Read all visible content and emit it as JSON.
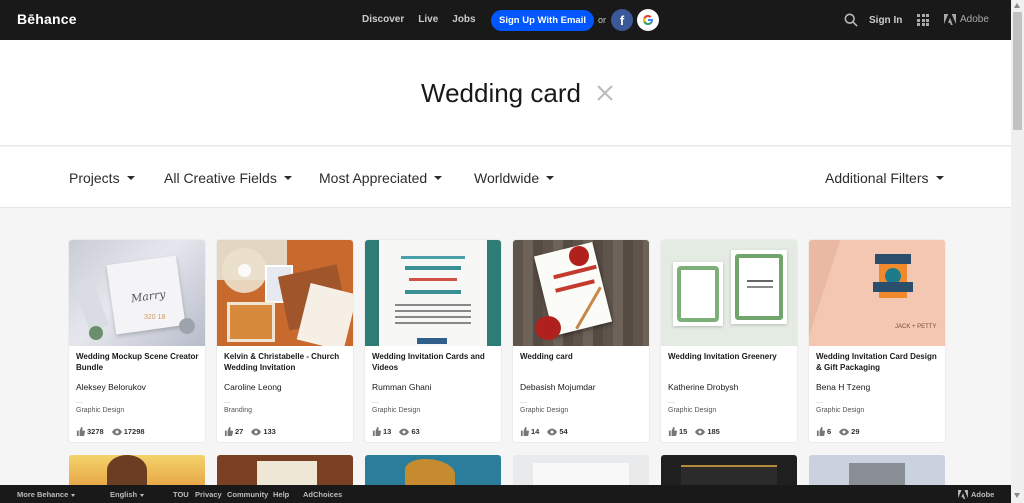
{
  "nav": {
    "logo": "Bēhance",
    "links": [
      "Discover",
      "Live",
      "Jobs"
    ],
    "signup": "Sign Up With Email",
    "or": "or",
    "signin": "Sign In",
    "adobe": "Adobe"
  },
  "search": {
    "query": "Wedding card"
  },
  "filters": {
    "projects": "Projects",
    "fields": "All Creative Fields",
    "sort": "Most Appreciated",
    "location": "Worldwide",
    "additional": "Additional Filters"
  },
  "cards": [
    {
      "title": "Wedding Mockup Scene Creator Bundle",
      "owner": "Aleksey Belorukov",
      "field": "Graphic Design",
      "likes": "3278",
      "views": "17298"
    },
    {
      "title": "Kelvin & Christabelle - Church Wedding Invitation",
      "owner": "Caroline Leong",
      "field": "Branding",
      "likes": "27",
      "views": "133"
    },
    {
      "title": "Wedding Invitation Cards and Videos",
      "owner": "Rumman Ghani",
      "field": "Graphic Design",
      "likes": "13",
      "views": "63"
    },
    {
      "title": "Wedding card",
      "owner": "Debasish Mojumdar",
      "field": "Graphic Design",
      "likes": "14",
      "views": "54"
    },
    {
      "title": "Wedding Invitation Greenery",
      "owner": "Katherine Drobysh",
      "field": "Graphic Design",
      "likes": "15",
      "views": "185"
    },
    {
      "title": "Wedding Invitation Card Design & Gift Packaging",
      "owner": "Bena H Tzeng",
      "field": "Graphic Design",
      "likes": "6",
      "views": "29"
    }
  ],
  "footer": {
    "more": "More Behance",
    "language": "English",
    "tou": "TOU",
    "privacy": "Privacy",
    "community": "Community",
    "help": "Help",
    "adchoices": "AdChoices",
    "adobe": "Adobe"
  },
  "colors": {
    "nav_bg": "#191919",
    "signup": "#0057ff",
    "facebook": "#3b5998",
    "page_bg": "#f5f5f5"
  }
}
